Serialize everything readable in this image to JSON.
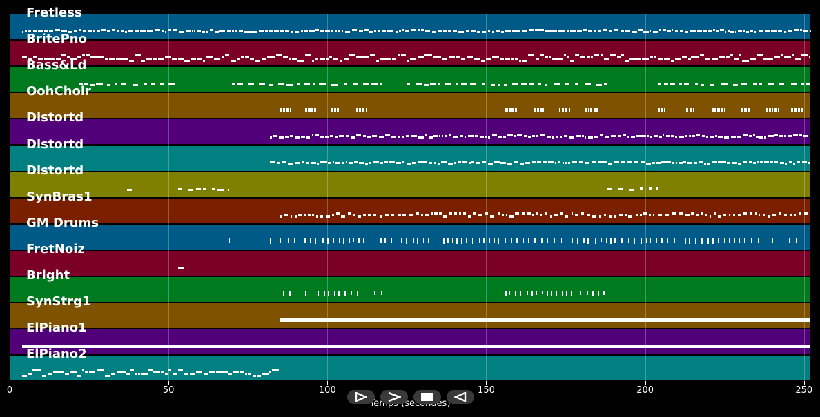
{
  "chart_data": {
    "type": "piano-roll",
    "xlabel": "Temps (secondes)",
    "xlim": [
      0,
      252
    ],
    "x_ticks": [
      0,
      50,
      100,
      150,
      200,
      250
    ],
    "grid": true,
    "tracks": [
      {
        "name": "Fretless",
        "color": "#005a87",
        "segments": [
          [
            4,
            252
          ]
        ],
        "style": "dense-thin"
      },
      {
        "name": "BritePno",
        "color": "#7a0028",
        "segments": [
          [
            4,
            252
          ]
        ],
        "style": "dense-double"
      },
      {
        "name": "Bass&Ld",
        "color": "#007a1e",
        "segments": [
          [
            22,
            52
          ],
          [
            70,
            117
          ],
          [
            125,
            188
          ],
          [
            204,
            252
          ]
        ],
        "style": "sparse"
      },
      {
        "name": "OohChoir",
        "color": "#7f5200",
        "segments": [
          [
            85,
            89
          ],
          [
            93,
            97
          ],
          [
            101,
            104
          ],
          [
            109,
            112
          ],
          [
            156,
            160
          ],
          [
            165,
            168
          ],
          [
            173,
            177
          ],
          [
            181,
            185
          ],
          [
            204,
            207
          ],
          [
            213,
            216
          ],
          [
            221,
            225
          ],
          [
            230,
            233
          ],
          [
            238,
            242
          ],
          [
            246,
            250
          ]
        ],
        "style": "blocks"
      },
      {
        "name": "Distortd",
        "color": "#52007a",
        "segments": [
          [
            82,
            252
          ]
        ],
        "style": "dense-thin"
      },
      {
        "name": "Distortd",
        "color": "#008080",
        "segments": [
          [
            82,
            252
          ]
        ],
        "style": "dense-thin"
      },
      {
        "name": "Distortd",
        "color": "#808000",
        "segments": [
          [
            37,
            39
          ],
          [
            53,
            55
          ],
          [
            56,
            69
          ],
          [
            188,
            204
          ]
        ],
        "style": "sparse"
      },
      {
        "name": "SynBras1",
        "color": "#7a2000",
        "segments": [
          [
            85,
            252
          ]
        ],
        "style": "dense-dashes"
      },
      {
        "name": "GM Drums",
        "color": "#005a87",
        "segments": [
          [
            69,
            70
          ],
          [
            82,
            252
          ]
        ],
        "style": "ticks"
      },
      {
        "name": "FretNoiz",
        "color": "#7a0028",
        "segments": [
          [
            53,
            56
          ]
        ],
        "style": "sparse"
      },
      {
        "name": "Bright",
        "color": "#007a1e",
        "segments": [
          [
            86,
            117
          ],
          [
            156,
            188
          ]
        ],
        "style": "ticks"
      },
      {
        "name": "SynStrg1",
        "color": "#7f5200",
        "segments": [
          [
            85,
            252
          ]
        ],
        "style": "solid"
      },
      {
        "name": "ElPiano1",
        "color": "#52007a",
        "segments": [
          [
            4,
            252
          ]
        ],
        "style": "solid"
      },
      {
        "name": "ElPiano2",
        "color": "#008080",
        "segments": [
          [
            4,
            85
          ]
        ],
        "style": "dense-double"
      }
    ]
  },
  "controls": [
    {
      "name": "play-icon",
      "symbol": "play"
    },
    {
      "name": "forward-icon",
      "symbol": "forward"
    },
    {
      "name": "stop-icon",
      "symbol": "stop"
    },
    {
      "name": "back-icon",
      "symbol": "back"
    }
  ]
}
